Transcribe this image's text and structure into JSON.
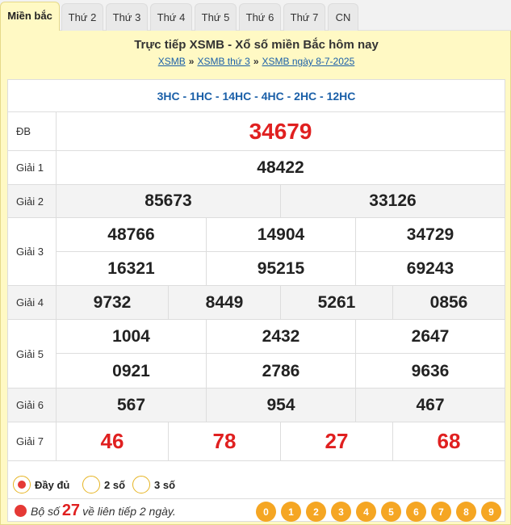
{
  "tabs": [
    {
      "label": "Miền bắc",
      "active": true
    },
    {
      "label": "Thứ 2"
    },
    {
      "label": "Thứ 3"
    },
    {
      "label": "Thứ 4"
    },
    {
      "label": "Thứ 5"
    },
    {
      "label": "Thứ 6"
    },
    {
      "label": "Thứ 7"
    },
    {
      "label": "CN"
    }
  ],
  "header": {
    "title": "Trực tiếp XSMB - Xổ số miền Bắc hôm nay",
    "breadcrumb": [
      "XSMB",
      "XSMB thứ 3",
      "XSMB ngày 8-7-2025"
    ],
    "separator": "»"
  },
  "codes": "3HC - 1HC - 14HC - 4HC - 2HC - 12HC",
  "prizes": {
    "db": {
      "label": "ĐB",
      "numbers": [
        "34679"
      ]
    },
    "g1": {
      "label": "Giải 1",
      "numbers": [
        "48422"
      ]
    },
    "g2": {
      "label": "Giải 2",
      "numbers": [
        "85673",
        "33126"
      ]
    },
    "g3": {
      "label": "Giải 3",
      "numbers": [
        "48766",
        "14904",
        "34729",
        "16321",
        "95215",
        "69243"
      ]
    },
    "g4": {
      "label": "Giải 4",
      "numbers": [
        "9732",
        "8449",
        "5261",
        "0856"
      ]
    },
    "g5": {
      "label": "Giải 5",
      "numbers": [
        "1004",
        "2432",
        "2647",
        "0921",
        "2786",
        "9636"
      ]
    },
    "g6": {
      "label": "Giải 6",
      "numbers": [
        "567",
        "954",
        "467"
      ]
    },
    "g7": {
      "label": "Giải 7",
      "numbers": [
        "46",
        "78",
        "27",
        "68"
      ]
    }
  },
  "options": [
    {
      "label": "Đầy đủ",
      "selected": true
    },
    {
      "label": "2 số",
      "selected": false
    },
    {
      "label": "3 số",
      "selected": false
    }
  ],
  "loto": {
    "prefix": "Bộ số",
    "number": "27",
    "suffix": "về liên tiếp 2 ngày."
  },
  "digits": [
    "0",
    "1",
    "2",
    "3",
    "4",
    "5",
    "6",
    "7",
    "8",
    "9"
  ],
  "colors": {
    "accent_red": "#e02020",
    "link_blue": "#1a5fa8",
    "panel_yellow": "#fff9c4",
    "digit_orange": "#f5a623"
  }
}
